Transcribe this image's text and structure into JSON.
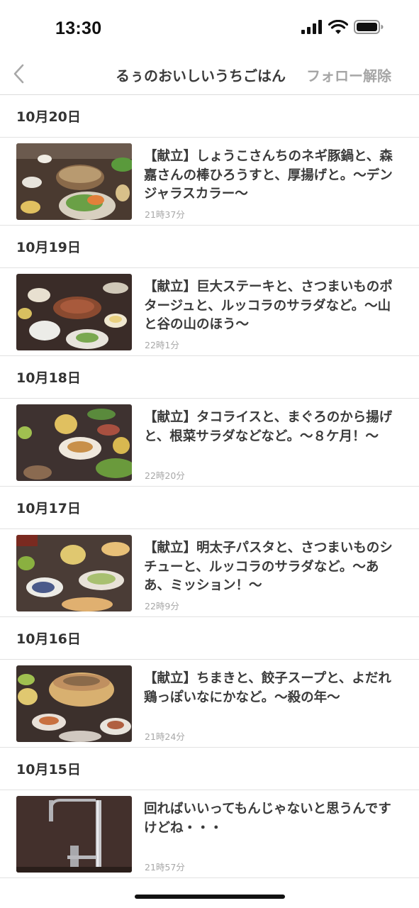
{
  "status_bar": {
    "time": "13:30",
    "icons": [
      "cellular-signal-icon",
      "wifi-icon",
      "battery-icon"
    ]
  },
  "nav": {
    "back_icon": "chevron-left-icon",
    "title": "るぅのおいしいうちごはん",
    "unfollow_label": "フォロー解除"
  },
  "sections": [
    {
      "date": "10月20日",
      "entry": {
        "title": "【献立】しょうこさんちのネギ豚鍋と、森嘉さんの棒ひろうすと、厚揚げと。〜デンジャラスカラー〜",
        "time": "21時37分",
        "thumbnail": "hot-pot-dinner-photo"
      }
    },
    {
      "date": "10月19日",
      "entry": {
        "title": "【献立】巨大ステーキと、さつまいものポタージュと、ルッコラのサラダなど。〜山と谷の山のほう〜",
        "time": "22時1分",
        "thumbnail": "steak-dinner-photo"
      }
    },
    {
      "date": "10月18日",
      "entry": {
        "title": "【献立】タコライスと、まぐろのから揚げと、根菜サラダなどなど。〜８ケ月！〜",
        "time": "22時20分",
        "thumbnail": "taco-rice-dinner-photo"
      }
    },
    {
      "date": "10月17日",
      "entry": {
        "title": "【献立】明太子パスタと、さつまいものシチューと、ルッコラのサラダなど。〜ああ、ミッション！〜",
        "time": "22時9分",
        "thumbnail": "mentaiko-pasta-dinner-photo"
      }
    },
    {
      "date": "10月16日",
      "entry": {
        "title": "【献立】ちまきと、餃子スープと、よだれ鶏っぽいなにかなど。〜殺の年〜",
        "time": "21時24分",
        "thumbnail": "chimaki-steamer-dinner-photo"
      }
    },
    {
      "date": "10月15日",
      "entry": {
        "title": "回ればいいってもんじゃないと思うんですけどね・・・",
        "time": "21時57分",
        "thumbnail": "kitchen-faucet-photo"
      }
    }
  ],
  "colors": {
    "separator": "#e2e2e2",
    "muted_text": "#a8a8a8",
    "title_text": "#3b3b3b",
    "unfollow_text": "#a6a6a6"
  }
}
